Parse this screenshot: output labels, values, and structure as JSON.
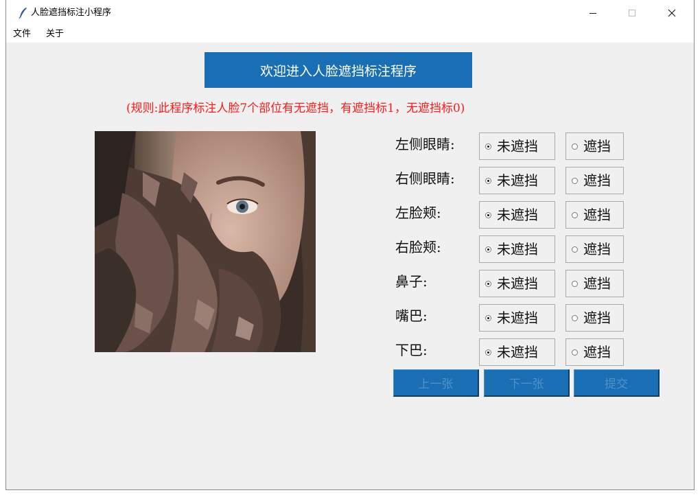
{
  "window": {
    "title": "人脸遮挡标注小程序",
    "controls": {
      "minimize": "minimize-icon",
      "maximize": "maximize-icon",
      "close": "close-icon"
    }
  },
  "menu": {
    "items": [
      "文件",
      "关于"
    ]
  },
  "welcome_label": "欢迎进入人脸遮挡标注程序",
  "rule_text": "(规则:此程序标注人脸7个部位有无遮挡，有遮挡标1，无遮挡标0)",
  "image": {
    "description_icon": "face-photo"
  },
  "parts": [
    {
      "label": "左侧眼睛:",
      "selected": "未遮挡"
    },
    {
      "label": "右侧眼睛:",
      "selected": "未遮挡"
    },
    {
      "label": "左脸颊:",
      "selected": "未遮挡"
    },
    {
      "label": "右脸颊:",
      "selected": "未遮挡"
    },
    {
      "label": "鼻子:",
      "selected": "未遮挡"
    },
    {
      "label": "嘴巴:",
      "selected": "未遮挡"
    },
    {
      "label": "下巴:",
      "selected": "未遮挡"
    }
  ],
  "options": {
    "not_occluded": "未遮挡",
    "occluded": "遮挡"
  },
  "buttons": {
    "prev": "上一张",
    "next": "下一张",
    "submit": "提交"
  },
  "colors": {
    "accent": "#1a6fb4",
    "rule": "#ff1a1a",
    "disabled_text": "#4f92c8"
  }
}
